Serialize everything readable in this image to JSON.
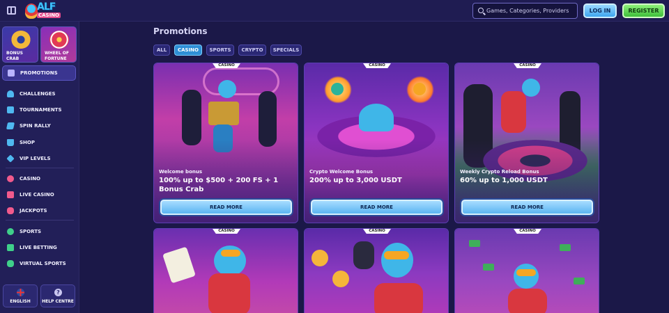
{
  "header": {
    "logo_text": "ALF",
    "logo_sub": "CASINO",
    "search_placeholder": "Games, Categories, Providers",
    "login_label": "LOG IN",
    "register_label": "REGISTER"
  },
  "sidebar": {
    "tiles": [
      {
        "label_line1": "BONUS",
        "label_line2": "CRAB"
      },
      {
        "label_line1": "WHEEL OF",
        "label_line2": "FORTUNE"
      }
    ],
    "active_item": "PROMOTIONS",
    "groups": [
      [
        "CHALLENGES",
        "TOURNAMENTS",
        "SPIN RALLY",
        "SHOP",
        "VIP LEVELS"
      ],
      [
        "CASINO",
        "LIVE CASINO",
        "JACKPOTS"
      ],
      [
        "SPORTS",
        "LIVE BETTING",
        "VIRTUAL SPORTS"
      ]
    ],
    "footer": {
      "language": "ENGLISH",
      "help": "HELP CENTRE"
    }
  },
  "main": {
    "title": "Promotions",
    "filters": [
      "ALL",
      "CASINO",
      "SPORTS",
      "CRYPTO",
      "SPECIALS"
    ],
    "active_filter": "CASINO",
    "cards": [
      {
        "badge": "CASINO",
        "subtitle": "Welcome bonus",
        "title": "100% up to $500 + 200 FS + 1 Bonus Crab",
        "cta": "READ MORE"
      },
      {
        "badge": "CASINO",
        "subtitle": "Crypto Welcome Bonus",
        "title": "200% up to 3,000 USDT",
        "cta": "READ MORE"
      },
      {
        "badge": "CASINO",
        "subtitle": "Weekly Crypto Reload Bonus",
        "title": "60% up to 1,000 USDT",
        "cta": "READ MORE"
      },
      {
        "badge": "CASINO"
      },
      {
        "badge": "CASINO"
      },
      {
        "badge": "CASINO"
      }
    ]
  },
  "colors": {
    "background": "#1b1848",
    "sidebar": "#221f58",
    "accent_blue": "#3ea6ef",
    "accent_green": "#3fbf3a"
  }
}
